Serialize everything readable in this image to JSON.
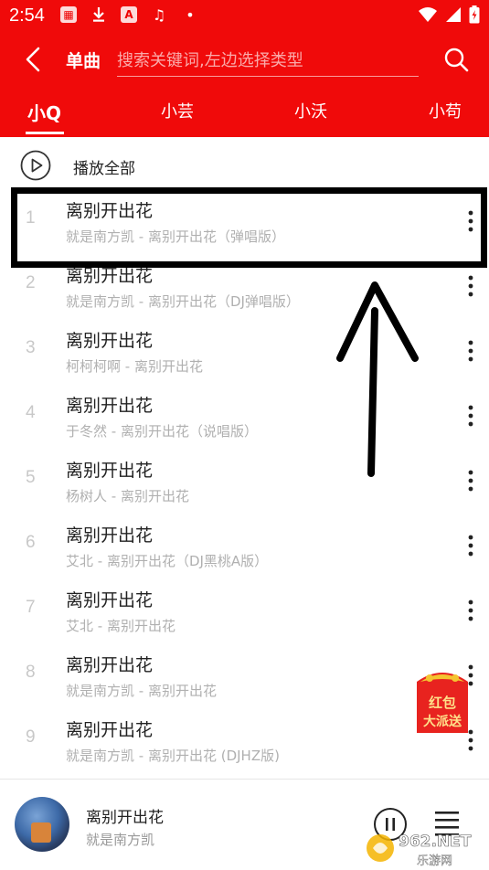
{
  "status_bar": {
    "time": "2:54",
    "left_icons": [
      "app-icon",
      "download-icon",
      "a-icon",
      "music-icon",
      "dot-icon"
    ],
    "right_icons": [
      "wifi-icon",
      "signal-icon",
      "battery-icon"
    ]
  },
  "toolbar": {
    "title": "单曲",
    "search_placeholder": "搜索关键词,左边选择类型"
  },
  "tabs": [
    {
      "label": "小Q",
      "active": true
    },
    {
      "label": "小芸",
      "active": false
    },
    {
      "label": "小沃",
      "active": false
    },
    {
      "label": "小苟",
      "active": false
    }
  ],
  "play_all": {
    "label": "播放全部"
  },
  "songs": [
    {
      "index": "1",
      "title": "离别开出花",
      "subtitle": "就是南方凯 - 离别开出花（弹唱版）"
    },
    {
      "index": "2",
      "title": "离别开出花",
      "subtitle": "就是南方凯 - 离别开出花（DJ弹唱版）"
    },
    {
      "index": "3",
      "title": "离别开出花",
      "subtitle": "柯柯柯啊 - 离别开出花"
    },
    {
      "index": "4",
      "title": "离别开出花",
      "subtitle": "于冬然 - 离别开出花（说唱版）"
    },
    {
      "index": "5",
      "title": "离别开出花",
      "subtitle": "杨树人 - 离别开出花"
    },
    {
      "index": "6",
      "title": "离别开出花",
      "subtitle": "艾北 - 离别开出花（DJ黑桃A版）"
    },
    {
      "index": "7",
      "title": "离别开出花",
      "subtitle": "艾北 - 离别开出花"
    },
    {
      "index": "8",
      "title": "离别开出花",
      "subtitle": "就是南方凯 - 离别开出花"
    },
    {
      "index": "9",
      "title": "离别开出花",
      "subtitle": "就是南方凯 - 离别开出花 (DJHZ版)"
    }
  ],
  "promo": {
    "line1": "红包",
    "line2": "大派送"
  },
  "now_playing": {
    "title": "离别开出花",
    "artist": "就是南方凯"
  },
  "watermark": {
    "brand": "962.NET",
    "sub": "乐游网"
  },
  "colors": {
    "brand_red": "#f00a0a",
    "highlight_border": "#000000"
  }
}
